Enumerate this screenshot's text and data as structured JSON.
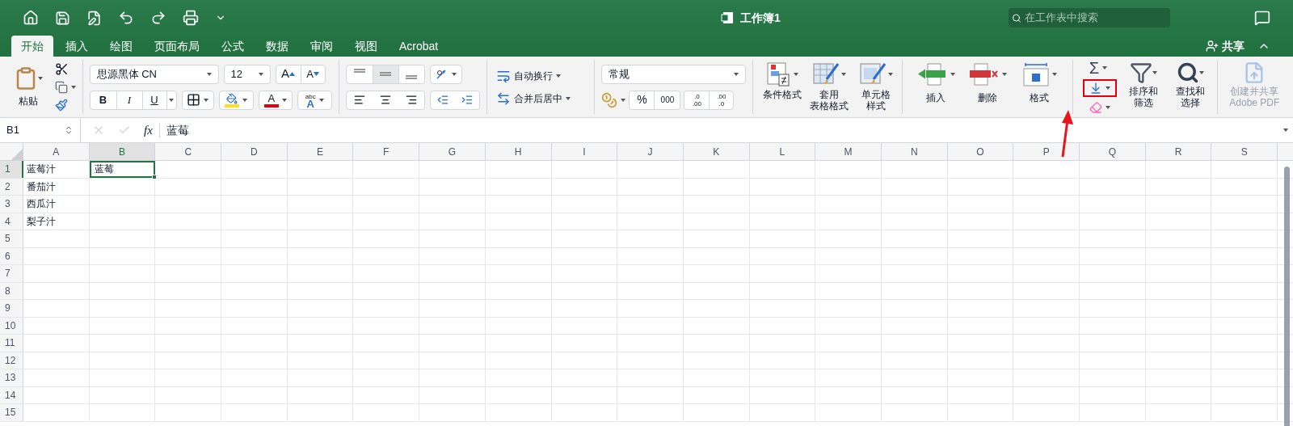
{
  "window": {
    "title": "工作簿1"
  },
  "search": {
    "placeholder": "在工作表中搜索"
  },
  "tabs": [
    {
      "label": "开始",
      "selected": true
    },
    {
      "label": "插入",
      "selected": false
    },
    {
      "label": "绘图",
      "selected": false
    },
    {
      "label": "页面布局",
      "selected": false
    },
    {
      "label": "公式",
      "selected": false
    },
    {
      "label": "数据",
      "selected": false
    },
    {
      "label": "审阅",
      "selected": false
    },
    {
      "label": "视图",
      "selected": false
    },
    {
      "label": "Acrobat",
      "selected": false
    }
  ],
  "share_button": {
    "label": "共享"
  },
  "ribbon": {
    "paste": {
      "label": "粘贴"
    },
    "font": {
      "name": "思源黑体 CN",
      "size": "12",
      "grow": "A",
      "shrink": "A",
      "bold": "B",
      "italic": "I",
      "underline": "U",
      "font_color_letter": "A",
      "effects": [
        "abc",
        "A"
      ]
    },
    "alignment": {
      "wrap_text": "自动换行",
      "merge": "合并后居中"
    },
    "number": {
      "format": "常规",
      "percent": "%",
      "thousands": "000",
      "add_decimal": [
        ".0",
        ".00"
      ],
      "remove_decimal": [
        ".00",
        ".0"
      ]
    },
    "styles": [
      {
        "kind": "conditional",
        "lines": [
          "条件格式"
        ]
      },
      {
        "kind": "table",
        "lines": [
          "套用",
          "表格格式"
        ]
      },
      {
        "kind": "cell",
        "lines": [
          "单元格",
          "样式"
        ]
      }
    ],
    "cells": [
      {
        "kind": "insert",
        "label": "插入"
      },
      {
        "kind": "delete",
        "label": "删除"
      },
      {
        "kind": "format",
        "label": "格式"
      }
    ],
    "editing": {
      "autosum": "Σ",
      "sort": [
        "排序和",
        "筛选"
      ],
      "find": [
        "查找和",
        "选择"
      ]
    },
    "acrobat": {
      "lines": [
        "创建并共享",
        "Adobe PDF"
      ],
      "disabled": true
    }
  },
  "formula_bar": {
    "name_box": "B1",
    "fx": "fx",
    "content": "蓝莓"
  },
  "sheet": {
    "columns": [
      {
        "label": "A",
        "selected": false
      },
      {
        "label": "B",
        "selected": true
      },
      {
        "label": "C",
        "selected": false
      },
      {
        "label": "D",
        "selected": false
      },
      {
        "label": "E",
        "selected": false
      },
      {
        "label": "F",
        "selected": false
      },
      {
        "label": "G",
        "selected": false
      },
      {
        "label": "H",
        "selected": false
      },
      {
        "label": "I",
        "selected": false
      },
      {
        "label": "J",
        "selected": false
      },
      {
        "label": "K",
        "selected": false
      },
      {
        "label": "L",
        "selected": false
      },
      {
        "label": "M",
        "selected": false
      },
      {
        "label": "N",
        "selected": false
      },
      {
        "label": "O",
        "selected": false
      },
      {
        "label": "P",
        "selected": false
      },
      {
        "label": "Q",
        "selected": false
      },
      {
        "label": "R",
        "selected": false
      },
      {
        "label": "S",
        "selected": false
      }
    ],
    "rows": [
      {
        "label": "1",
        "selected": true,
        "cells": [
          {
            "text": "蓝莓汁",
            "selected": false
          },
          {
            "text": "蓝莓",
            "selected": true
          }
        ]
      },
      {
        "label": "2",
        "selected": false,
        "cells": [
          {
            "text": "番茄汁",
            "selected": false
          }
        ]
      },
      {
        "label": "3",
        "selected": false,
        "cells": [
          {
            "text": "西瓜汁",
            "selected": false
          }
        ]
      },
      {
        "label": "4",
        "selected": false,
        "cells": [
          {
            "text": "梨子汁",
            "selected": false
          }
        ]
      },
      {
        "label": "5",
        "selected": false
      },
      {
        "label": "6",
        "selected": false
      },
      {
        "label": "7",
        "selected": false
      },
      {
        "label": "8",
        "selected": false
      },
      {
        "label": "9",
        "selected": false
      },
      {
        "label": "10",
        "selected": false
      },
      {
        "label": "11",
        "selected": false
      },
      {
        "label": "12",
        "selected": false
      },
      {
        "label": "13",
        "selected": false
      },
      {
        "label": "14",
        "selected": false
      },
      {
        "label": "15",
        "selected": false
      }
    ]
  }
}
